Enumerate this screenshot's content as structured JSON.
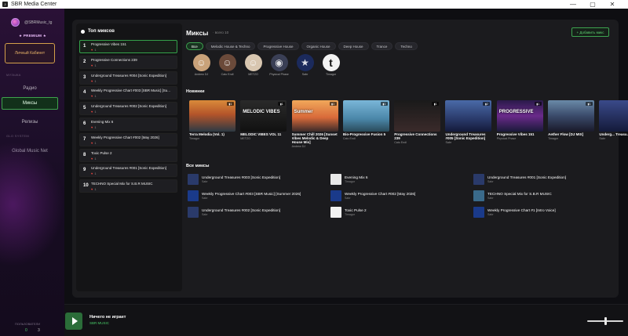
{
  "window": {
    "title": "SBR Media Center",
    "minimize": "—",
    "maximize": "▢",
    "close": "✕"
  },
  "sidebar": {
    "user": "@SBRMusic_tg",
    "premium": "★ PREMIUM ★",
    "cabinet": "Личный Кабинет",
    "section_music": "МУЗЫКА",
    "nav": [
      {
        "label": "Радио",
        "active": false
      },
      {
        "label": "Миксы",
        "active": true
      },
      {
        "label": "Релизы",
        "active": false
      }
    ],
    "section_system": "GLO SYSTEM",
    "global": "Global Music Net",
    "stats_label": "ПОЛЬЗОВАТЕЛИ",
    "stat1": "0",
    "stat2": "3"
  },
  "top_mixes": {
    "title": "Топ миксов",
    "items": [
      {
        "num": "1",
        "name": "Progressive Vibes 151",
        "count": "1",
        "selected": true
      },
      {
        "num": "2",
        "name": "Progressive Connections 239",
        "count": "1"
      },
      {
        "num": "3",
        "name": "Underground Treasures #004 [Sonic Expedition]",
        "count": "1"
      },
      {
        "num": "4",
        "name": "Weekly Progressive Chart #003 [SBR Music] [Su...",
        "count": "1"
      },
      {
        "num": "5",
        "name": "Underground Treasures #002 [Sonic Expedition]",
        "count": "1"
      },
      {
        "num": "6",
        "name": "Evening Mix 6",
        "count": "1"
      },
      {
        "num": "7",
        "name": "Weekly Progressive Chart #002 [May 2026]",
        "count": "1"
      },
      {
        "num": "8",
        "name": "Toxic Pulse 2",
        "count": "1"
      },
      {
        "num": "9",
        "name": "Underground Treasures #001 [Sonic Expedition]",
        "count": "1"
      },
      {
        "num": "10",
        "name": "TECHNO Special Mix for S.B.R MUSIC",
        "count": "1"
      }
    ]
  },
  "mixes": {
    "title": "Миксы",
    "count": "· всего 10",
    "add_button": "+ Добавить микс",
    "genres": [
      {
        "label": "Все",
        "active": true
      },
      {
        "label": "Melodic House & Techno"
      },
      {
        "label": "Progressive House"
      },
      {
        "label": "Organic House"
      },
      {
        "label": "Deep House"
      },
      {
        "label": "Trance"
      },
      {
        "label": "Techno"
      }
    ],
    "artists": [
      {
        "name": "Andrew DJ",
        "bg": "#c9a27a",
        "glyph": "☺"
      },
      {
        "name": "Cato Endl",
        "bg": "#6b4a3a",
        "glyph": "☺"
      },
      {
        "name": "METZO",
        "bg": "#d8c6b0",
        "glyph": "☺"
      },
      {
        "name": "Physical Phase",
        "bg": "#3a3f55",
        "glyph": "◉"
      },
      {
        "name": "Sabr",
        "bg": "#1b2a5c",
        "glyph": "★"
      },
      {
        "name": "Timagor",
        "bg": "#f2f2f2",
        "glyph": "t"
      }
    ],
    "new_title": "Новинки",
    "new_items": [
      {
        "title": "Terra Melodia (Vol. 1)",
        "artist": "Timagor",
        "badge": "1",
        "bg": "linear-gradient(180deg,#d98a3a 0%,#b4542a 45%,#2c3a44 100%)",
        "overlay": ""
      },
      {
        "title": "MELODIC VIBES VOL 11",
        "artist": "METZO",
        "badge": "1",
        "bg": "linear-gradient(180deg,#2a2a2a,#111)",
        "overlay": "MELODIC VIBES"
      },
      {
        "title": "Summer Chill 2026 [Sunset Vibes Melodic & Deep House Mix]",
        "artist": "Andrew DJ",
        "badge": "1",
        "bg": "linear-gradient(180deg,#f1a85a 0%,#d86a3a 55%,#3a2a2a 100%)",
        "overlay": "Summer"
      },
      {
        "title": "Bio-Progressive Fusion 5",
        "artist": "Cato Endl",
        "badge": "1",
        "bg": "linear-gradient(180deg,#7ab6d8 0%,#4a86a8 60%,#2a4a5a 100%)",
        "overlay": ""
      },
      {
        "title": "Progressive Connections 239",
        "artist": "Cato Endl",
        "badge": "1",
        "bg": "linear-gradient(180deg,#1a1a1a,#3a2a2a)",
        "overlay": ""
      },
      {
        "title": "Underground Treasures #005 [Sonic Expedition]",
        "artist": "Sabr",
        "badge": "2",
        "bg": "linear-gradient(180deg,#4a6aa8 0%,#2a3a6a 60%,#141a3a 100%)",
        "overlay": ""
      },
      {
        "title": "Progressive Vibes 151",
        "artist": "Physical Phase",
        "badge": "1",
        "bg": "linear-gradient(180deg,#2a1a4a 0%,#6a2a8a 50%,#1a1a3a 100%)",
        "overlay": "PROGRESSIVE"
      },
      {
        "title": "Aether Flow [DJ MIX]",
        "artist": "Timagor",
        "badge": "1",
        "bg": "linear-gradient(180deg,#6a8aa8 0%,#3a4a6a 50%,#1a1a2a 100%)",
        "overlay": ""
      },
      {
        "title": "Underg... Treasu... Exped...",
        "artist": "Sabr",
        "badge": "1",
        "bg": "linear-gradient(180deg,#3a4a8a,#141a3a)",
        "overlay": ""
      }
    ],
    "all_title": "Все миксы",
    "all_items": [
      {
        "name": "Underground Treasures #003 [Sonic Expedition]",
        "artist": "Sabr",
        "bg": "#2a3a6a"
      },
      {
        "name": "Evening Mix 6",
        "artist": "Timagor",
        "bg": "#e8e8e8"
      },
      {
        "name": "Underground Treasures #001 [Sonic Expedition]",
        "artist": "Sabr",
        "bg": "#2a3a6a"
      },
      {
        "name": "Weekly Progressive Chart #003 [SBR Music] [Summer 2026]",
        "artist": "Sabr",
        "bg": "#1a3a8a"
      },
      {
        "name": "Weekly Progressive Chart #002 [May 2026]",
        "artist": "Sabr",
        "bg": "#1a3a8a"
      },
      {
        "name": "TECHNO Special Mix for S.B.R MUSIC",
        "artist": "Sabr",
        "bg": "#3a6a8a"
      },
      {
        "name": "Underground Treasures #002 [Sonic Expedition]",
        "artist": "Sabr",
        "bg": "#2a3a6a"
      },
      {
        "name": "Toxic Pulse 2",
        "artist": "Timagor",
        "bg": "#f2f2f2"
      },
      {
        "name": "Weekly Progressive Chart #1 [Intro Voice]",
        "artist": "Sabr",
        "bg": "#1a3a8a"
      }
    ]
  },
  "player": {
    "title": "Ничего не играет",
    "subtitle": "SBR MUSIC",
    "volume": 0.52
  }
}
